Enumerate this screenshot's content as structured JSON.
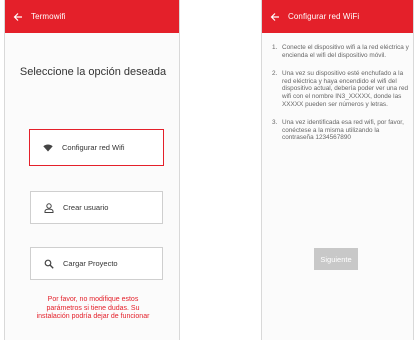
{
  "colors": {
    "accent": "#e4202a",
    "disabled_button": "#c8c8c8"
  },
  "left_screen": {
    "appbar": {
      "back_icon": "arrow-left-icon",
      "title": "Termowifi"
    },
    "prompt": "Seleccione la opción deseada",
    "options": [
      {
        "icon": "wifi-icon",
        "label": "Configurar red Wifi",
        "selected": true
      },
      {
        "icon": "user-icon",
        "label": "Crear usuario",
        "selected": false
      },
      {
        "icon": "search-icon",
        "label": "Cargar Proyecto",
        "selected": false
      }
    ],
    "warning": {
      "line1": "Por favor, no modifique estos",
      "line2": "parámetros si tiene dudas. Su",
      "line3": "instalación podría dejar de funcionar"
    }
  },
  "right_screen": {
    "appbar": {
      "back_icon": "arrow-left-icon",
      "title": "Configurar red WiFi"
    },
    "steps": [
      {
        "number": "1.",
        "text": "Conecte el dispositivo wifi a la red eléctrica y encienda el wifi del dispositivo móvil."
      },
      {
        "number": "2.",
        "text": "Una vez su dispositivo esté enchufado a la red eléctrica y haya encendido el wifi del dispositivo actual, debería poder ver una red wifi con el nombre IN3_XXXXX, donde las XXXXX pueden ser números y letras."
      },
      {
        "number": "3.",
        "text": "Una vez identificada esa red wifi, por favor, conéctese a la misma utilizando la contraseña 1234567890"
      }
    ],
    "next_button": "Siguiente"
  }
}
